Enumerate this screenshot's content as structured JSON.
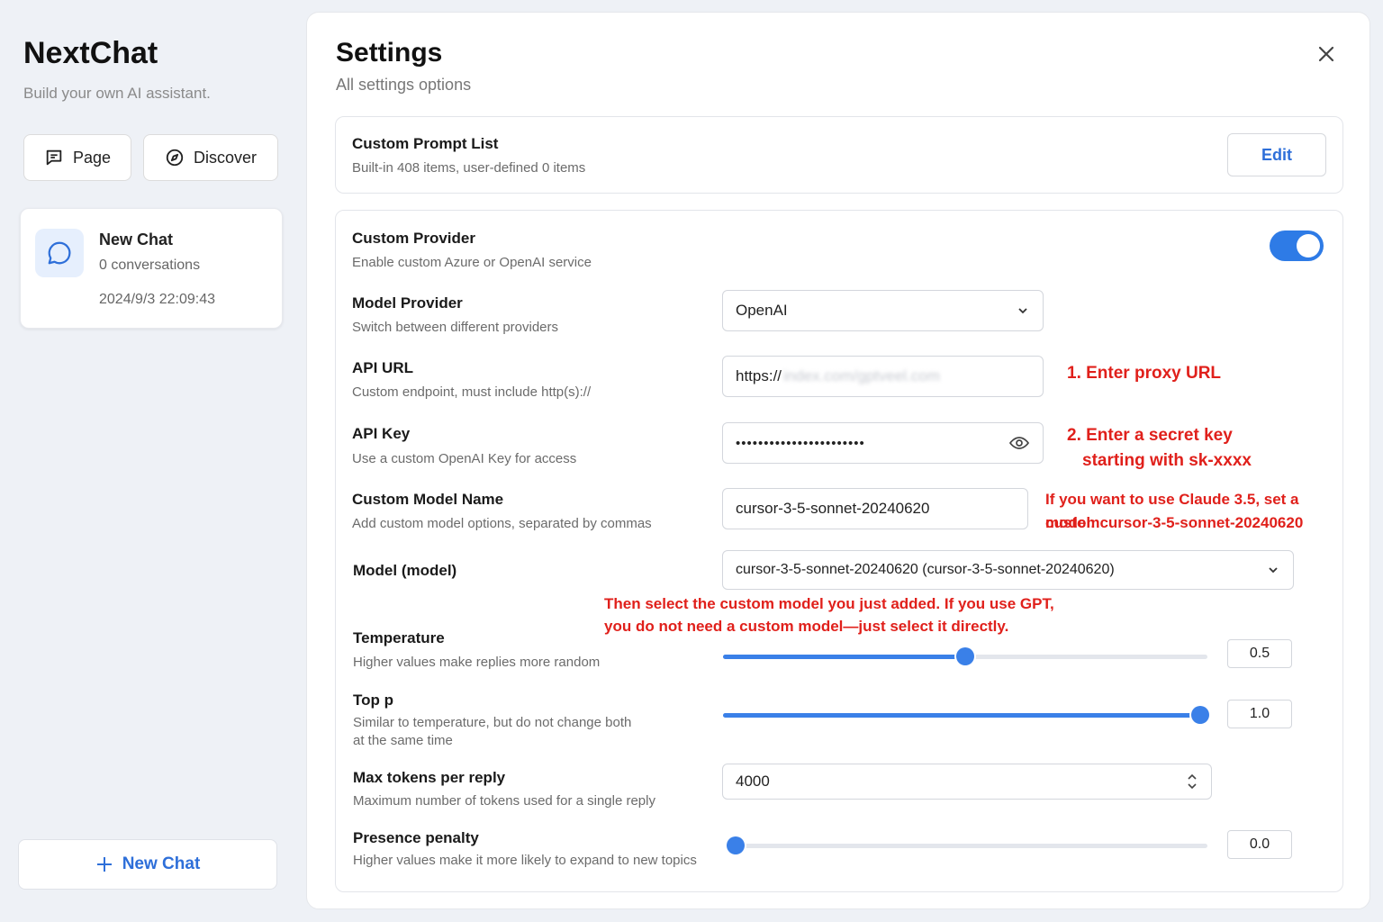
{
  "sidebar": {
    "title": "NextChat",
    "subtitle": "Build your own AI assistant.",
    "page_button": "Page",
    "discover_button": "Discover",
    "chat": {
      "title": "New Chat",
      "count": "0 conversations",
      "date": "2024/9/3 22:09:43"
    },
    "new_chat_button": "New Chat"
  },
  "settings": {
    "title": "Settings",
    "subtitle": "All settings options",
    "prompt_list": {
      "label": "Custom Prompt List",
      "desc": "Built-in 408 items, user-defined 0 items",
      "edit_button": "Edit"
    },
    "custom_provider": {
      "label": "Custom Provider",
      "desc": "Enable custom Azure or OpenAI service",
      "enabled": true
    },
    "model_provider": {
      "label": "Model Provider",
      "desc": "Switch between different providers",
      "value": "OpenAI"
    },
    "api_url": {
      "label": "API URL",
      "desc": "Custom endpoint, must include http(s)://",
      "value": "https://",
      "blurred": "index.com/gptveel.com"
    },
    "api_key": {
      "label": "API Key",
      "desc": "Use a custom OpenAI Key for access",
      "value": "•••••••••••••••••••••••"
    },
    "custom_model": {
      "label": "Custom Model Name",
      "desc": "Add custom model options, separated by commas",
      "value": "cursor-3-5-sonnet-20240620"
    },
    "model": {
      "label": "Model (model)",
      "value": "cursor-3-5-sonnet-20240620 (cursor-3-5-sonnet-20240620)"
    },
    "temperature": {
      "label": "Temperature",
      "desc": "Higher values make replies more random",
      "value": "0.5",
      "fraction": 0.5
    },
    "top_p": {
      "label": "Top p",
      "desc": "Similar to temperature, but do not change both",
      "desc2": "at the same time",
      "value": "1.0",
      "fraction": 1.0
    },
    "max_tokens": {
      "label": "Max tokens per reply",
      "desc": "Maximum number of tokens used for a single reply",
      "value": "4000"
    },
    "presence_penalty": {
      "label": "Presence penalty",
      "desc": "Higher values make it more likely to expand to new topics",
      "value": "0.0",
      "fraction": 0.0
    }
  },
  "annotations": {
    "proxy_url": "1. Enter proxy URL",
    "secret_key_1": "2. Enter a secret key",
    "secret_key_2": "starting with sk-xxxx",
    "claude_1": "If you want to use Claude 3.5, set a custom",
    "claude_2": "model: cursor-3-5-sonnet-20240620",
    "select_1": "Then select the custom model you just added. If you use GPT,",
    "select_2": "you do not need a custom model—just select it directly."
  },
  "colors": {
    "accent": "#2e7be6",
    "annotation": "#e0201b"
  }
}
